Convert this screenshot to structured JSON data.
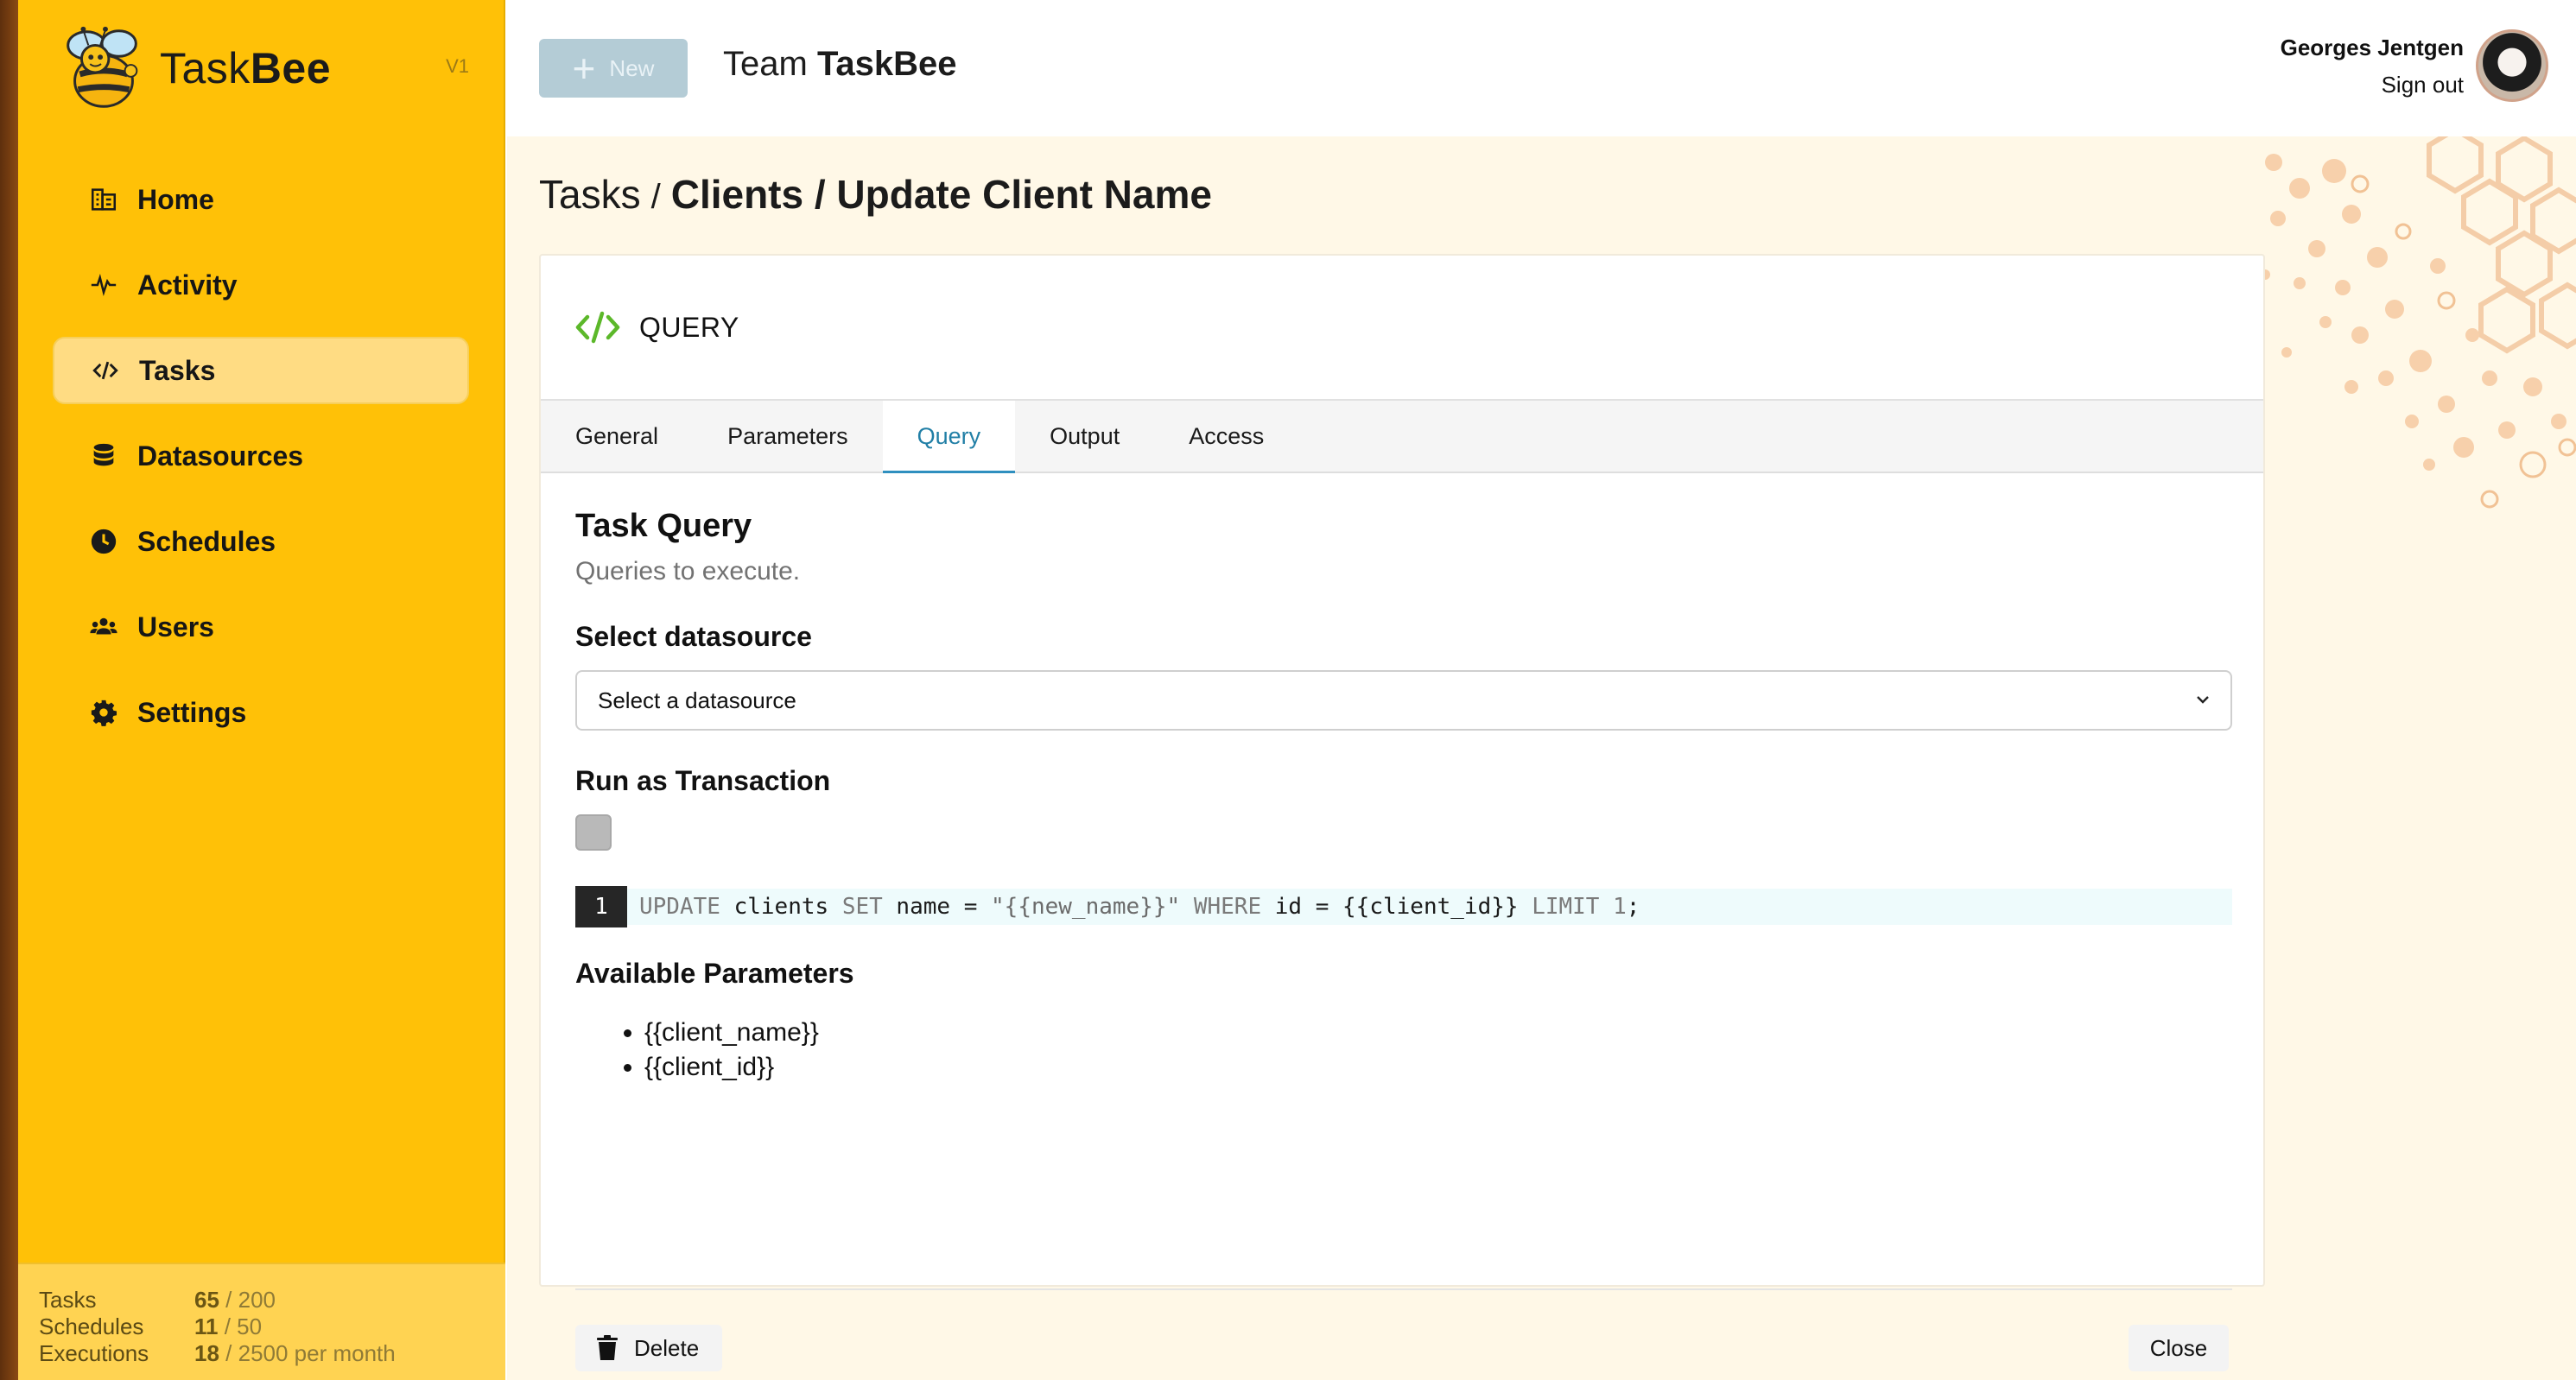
{
  "brand": {
    "name_light": "Task",
    "name_bold": "Bee",
    "version": "V1"
  },
  "sidebar": {
    "items": [
      {
        "label": "Home",
        "icon": "building-icon"
      },
      {
        "label": "Activity",
        "icon": "pulse-icon"
      },
      {
        "label": "Tasks",
        "icon": "code-icon",
        "active": true
      },
      {
        "label": "Datasources",
        "icon": "database-icon"
      },
      {
        "label": "Schedules",
        "icon": "clock-icon"
      },
      {
        "label": "Users",
        "icon": "users-icon"
      },
      {
        "label": "Settings",
        "icon": "gear-icon"
      }
    ],
    "usage": [
      {
        "label": "Tasks",
        "used": "65",
        "limit": "/ 200"
      },
      {
        "label": "Schedules",
        "used": "11",
        "limit": "/ 50"
      },
      {
        "label": "Executions",
        "used": "18",
        "limit": "/ 2500 per month"
      }
    ]
  },
  "header": {
    "new_label": "New",
    "team_prefix": "Team",
    "team_name": "TaskBee",
    "user_name": "Georges Jentgen",
    "sign_out": "Sign out"
  },
  "breadcrumb": {
    "root": "Tasks",
    "separator": "/",
    "current": "Clients / Update Client Name"
  },
  "card": {
    "title": "QUERY",
    "tabs": [
      "General",
      "Parameters",
      "Query",
      "Output",
      "Access"
    ],
    "active_tab": "Query",
    "section_title": "Task Query",
    "section_subtitle": "Queries to execute.",
    "datasource_label": "Select datasource",
    "datasource_placeholder": "Select a datasource",
    "transaction_label": "Run as Transaction",
    "editor": {
      "line_number": "1",
      "tokens": {
        "kw1": "UPDATE",
        "t1": " clients ",
        "kw2": "SET",
        "t2": " name = ",
        "str": "\"{{new_name}}\"",
        "t3": " ",
        "kw3": "WHERE",
        "t4": " id = {{client_id}} ",
        "kw4": "LIMIT",
        "t5": " ",
        "num": "1",
        "t6": ";"
      }
    },
    "params_title": "Available Parameters",
    "params": [
      "{{client_name}}",
      "{{client_id}}"
    ],
    "delete_label": "Delete",
    "close_label": "Close"
  },
  "colors": {
    "sidebar_bg": "#ffc107",
    "active_tab": "#217fa6",
    "main_bg": "#fff8e7"
  }
}
